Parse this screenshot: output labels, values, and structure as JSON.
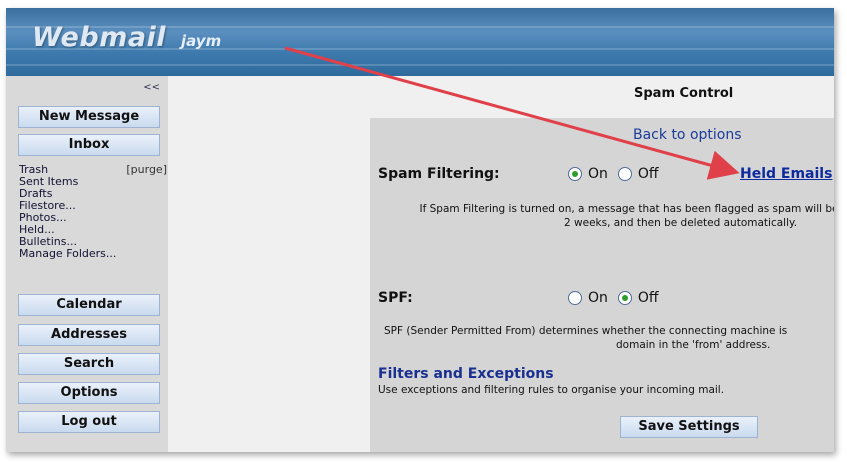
{
  "header": {
    "logo": "Webmail",
    "username": "jaym"
  },
  "sidebar": {
    "collapse": "<<",
    "new_message": "New Message",
    "inbox": "Inbox",
    "folders": [
      {
        "label": "Trash",
        "extra": "[purge]"
      },
      {
        "label": "Sent Items"
      },
      {
        "label": "Drafts"
      },
      {
        "label": "Filestore..."
      },
      {
        "label": "Photos..."
      },
      {
        "label": "Held..."
      },
      {
        "label": "Bulletins..."
      },
      {
        "label": "Manage Folders..."
      }
    ],
    "buttons": [
      "Calendar",
      "Addresses",
      "Search",
      "Options",
      "Log out"
    ]
  },
  "main": {
    "title": "Spam Control",
    "back": "Back to options",
    "spam": {
      "label": "Spam Filtering:",
      "on": "On",
      "off": "Off",
      "selected": "On",
      "held_link": "Held Emails",
      "desc1": "If Spam Filtering is turned on, a message that has been flagged as spam will be p",
      "desc2": "2 weeks, and then be deleted automatically."
    },
    "spf": {
      "label": "SPF:",
      "on": "On",
      "off": "Off",
      "selected": "Off",
      "desc1": "SPF (Sender Permitted From) determines whether the connecting machine is",
      "desc2": "domain in the 'from' address."
    },
    "filters": {
      "title": "Filters and Exceptions",
      "desc": "Use exceptions and filtering rules to organise your incoming mail."
    },
    "save": "Save Settings"
  },
  "annotation_color": "#e0404a"
}
